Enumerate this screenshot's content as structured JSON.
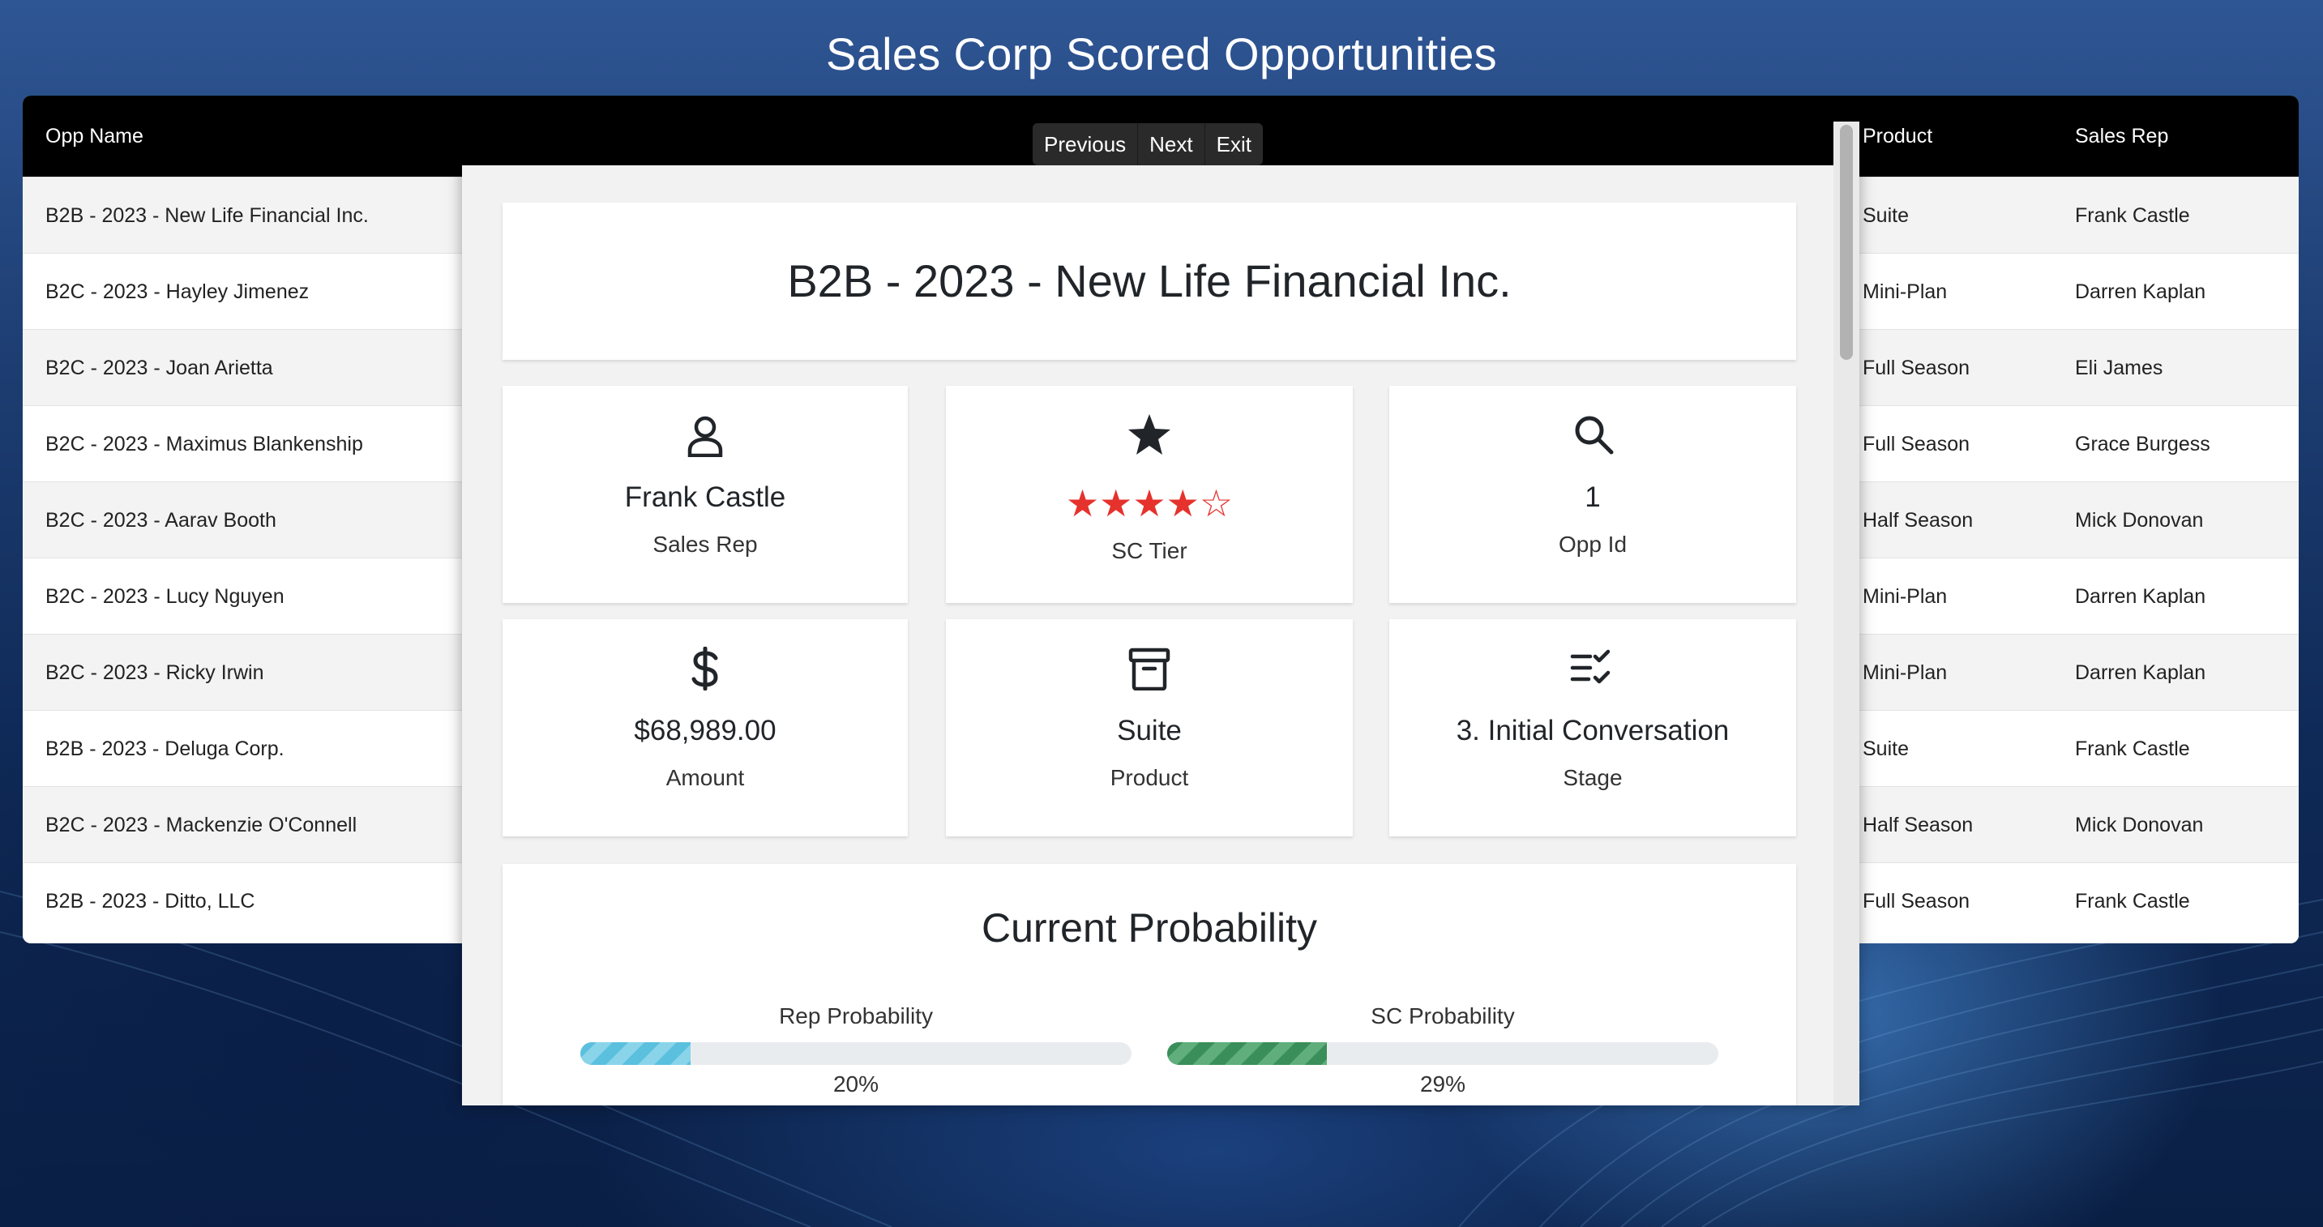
{
  "page": {
    "title": "Sales Corp Scored Opportunities"
  },
  "table": {
    "columns": {
      "opp_name": "Opp Name",
      "product": "Product",
      "sales_rep": "Sales Rep"
    },
    "rows": [
      {
        "name": "B2B - 2023 - New Life Financial Inc.",
        "product": "Suite",
        "rep": "Frank Castle"
      },
      {
        "name": "B2C - 2023 - Hayley Jimenez",
        "product": "Mini-Plan",
        "rep": "Darren Kaplan"
      },
      {
        "name": "B2C - 2023 - Joan Arietta",
        "product": "Full Season",
        "rep": "Eli James"
      },
      {
        "name": "B2C - 2023 - Maximus Blankenship",
        "product": "Full Season",
        "rep": "Grace Burgess"
      },
      {
        "name": "B2C - 2023 - Aarav Booth",
        "product": "Half Season",
        "rep": "Mick Donovan"
      },
      {
        "name": "B2C - 2023 - Lucy Nguyen",
        "product": "Mini-Plan",
        "rep": "Darren Kaplan"
      },
      {
        "name": "B2C - 2023 - Ricky Irwin",
        "product": "Mini-Plan",
        "rep": "Darren Kaplan"
      },
      {
        "name": "B2B - 2023 - Deluga Corp.",
        "product": "Suite",
        "rep": "Frank Castle"
      },
      {
        "name": "B2C - 2023 - Mackenzie O'Connell",
        "product": "Half Season",
        "rep": "Mick Donovan"
      },
      {
        "name": "B2B - 2023 - Ditto, LLC",
        "product": "Full Season",
        "rep": "Frank Castle"
      }
    ]
  },
  "modal": {
    "nav": {
      "previous": "Previous",
      "next": "Next",
      "exit": "Exit"
    },
    "opp_title": "B2B - 2023 - New Life Financial Inc.",
    "stats": {
      "sales_rep": {
        "value": "Frank Castle",
        "label": "Sales Rep",
        "icon": "person-icon"
      },
      "sc_tier": {
        "rating": 4,
        "max": 5,
        "label": "SC Tier",
        "icon": "star-icon"
      },
      "opp_id": {
        "value": "1",
        "label": "Opp Id",
        "icon": "search-icon"
      },
      "amount": {
        "value": "$68,989.00",
        "label": "Amount",
        "icon": "dollar-icon"
      },
      "product": {
        "value": "Suite",
        "label": "Product",
        "icon": "archive-box-icon"
      },
      "stage": {
        "value": "3. Initial Conversation",
        "label": "Stage",
        "icon": "checklist-icon"
      }
    },
    "probability": {
      "title": "Current Probability",
      "rep": {
        "label": "Rep Probability",
        "percent": 20,
        "text": "20%"
      },
      "sc": {
        "label": "SC Probability",
        "percent": 29,
        "text": "29%"
      }
    }
  },
  "colors": {
    "star": "#e5322d",
    "rep_bar": "#5bc0de",
    "sc_bar": "#3a8e5a",
    "header_bg": "#000000"
  }
}
